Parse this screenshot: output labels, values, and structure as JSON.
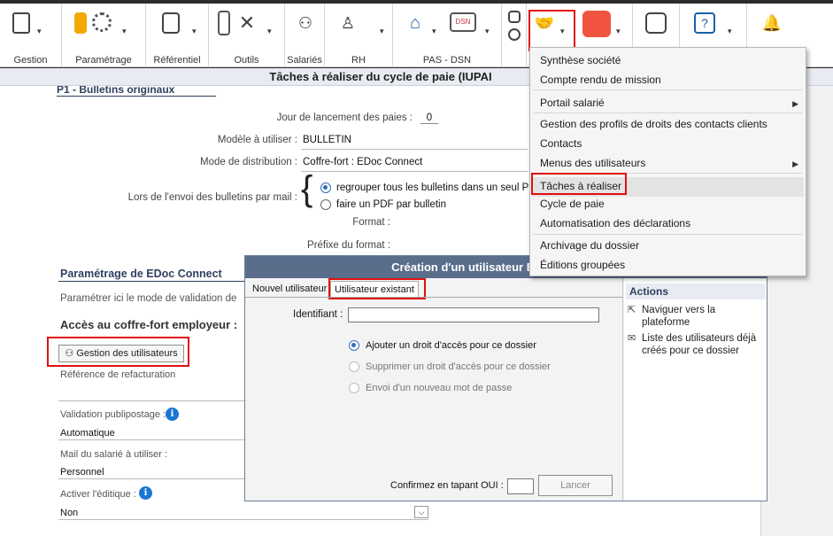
{
  "ribbon": {
    "groups": [
      "Gestion",
      "Paramétrage",
      "Référentiel",
      "Outils",
      "Salariés",
      "RH",
      "PAS - DSN"
    ]
  },
  "header": {
    "title": "Tâches à réaliser du cycle de paie (IUPAI"
  },
  "form": {
    "section_top": "P1 - Bulletins originaux",
    "jour_label": "Jour de lancement des paies :",
    "jour_value": "0",
    "modele_label": "Modèle à utiliser :",
    "modele_value": "BULLETIN",
    "mode_label": "Mode de distribution :",
    "mode_value": "Coffre-fort : EDoc Connect",
    "envoi_label": "Lors de l'envoi des bulletins par mail :",
    "envoi_option1": "regrouper tous les bulletins dans un seul PDF",
    "envoi_option2": "faire un PDF par bulletin",
    "format_label": "Format :",
    "prefixe_label": "Préfixe du format :",
    "edoc_section": "Paramétrage de EDoc Connect",
    "edoc_desc": "Paramétrer ici le mode de validation de",
    "coffre_title": "Accès au coffre-fort employeur :",
    "gestion_users_btn": "Gestion des utilisateurs",
    "refact_label": "Référence de refacturation",
    "validation_label": "Validation publipostage :",
    "validation_value": "Automatique",
    "mail_label": "Mail du salarié à utiliser :",
    "mail_value": "Personnel",
    "editique_label": "Activer l'éditique :",
    "editique_value": "Non"
  },
  "dialog": {
    "title": "Création d'un utilisateur EDoc Connect (D",
    "tab_new": "Nouvel utilisateur",
    "tab_existing": "Utilisateur existant",
    "identifiant_label": "Identifiant :",
    "identifiant_value": "",
    "radio1": "Ajouter un droit d'accès pour ce dossier",
    "radio2": "Supprimer un droit d'accès pour ce dossier",
    "radio3": "Envoi d'un nouveau mot de passe",
    "confirm_label": "Confirmez en tapant OUI :",
    "lancer": "Lancer",
    "actions_title": "Actions",
    "action1": "Naviguer vers la plateforme",
    "action2": "Liste des utilisateurs déjà créés pour ce dossier"
  },
  "menu": {
    "items": [
      "Synthèse société",
      "Compte rendu de mission",
      "Portail salarié",
      "Gestion des profils de droits des contacts clients",
      "Contacts",
      "Menus des utilisateurs",
      "Tâches à réaliser",
      "Cycle de paie",
      "Automatisation des déclarations",
      "Archivage du dossier",
      "Éditions groupées"
    ]
  },
  "colors": {
    "accent": "#2f6fb5",
    "highlight": "#e01010",
    "dialog_title": "#5a6e8c"
  },
  "icons": [
    "clipboard-icon",
    "gear-icon",
    "document-icon",
    "tools-icon",
    "people-icon",
    "person-hand-icon",
    "bank-icon",
    "dsn-icon",
    "handshake-icon",
    "myee-icon",
    "robot-icon",
    "help-icon",
    "bell-icon"
  ]
}
